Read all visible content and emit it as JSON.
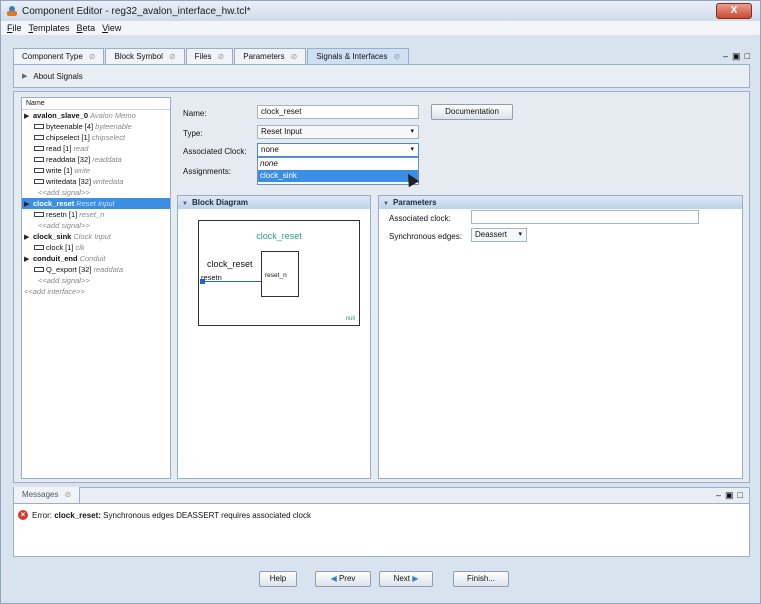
{
  "window": {
    "title": "Component Editor - reg32_avalon_interface_hw.tcl*",
    "close": "X"
  },
  "menu": [
    "File",
    "Templates",
    "Beta",
    "View"
  ],
  "tabs": [
    {
      "label": "Component Type"
    },
    {
      "label": "Block Symbol"
    },
    {
      "label": "Files"
    },
    {
      "label": "Parameters"
    },
    {
      "label": "Signals & Interfaces"
    }
  ],
  "tab_close_glyph": "⊘",
  "win_ctrls": [
    "–",
    "▣",
    "□"
  ],
  "about": "About Signals",
  "tree": {
    "header": "Name",
    "items": [
      {
        "label": "avalon_slave_0",
        "type": "Avalon Memo",
        "kind": "iface"
      },
      {
        "label": "byteenable [4]",
        "type": "byteenable",
        "kind": "sig"
      },
      {
        "label": "chipselect [1]",
        "type": "chipselect",
        "kind": "sig"
      },
      {
        "label": "read [1]",
        "type": "read",
        "kind": "sig"
      },
      {
        "label": "readdata [32]",
        "type": "readdata",
        "kind": "sig"
      },
      {
        "label": "write [1]",
        "type": "write",
        "kind": "sig"
      },
      {
        "label": "writedata [32]",
        "type": "writedata",
        "kind": "sig"
      },
      {
        "label": "<<add signal>>",
        "type": "",
        "kind": "add"
      },
      {
        "label": "clock_reset",
        "type": "Reset Input",
        "kind": "iface",
        "selected": true
      },
      {
        "label": "resetn [1]",
        "type": "reset_n",
        "kind": "sig"
      },
      {
        "label": "<<add signal>>",
        "type": "",
        "kind": "add"
      },
      {
        "label": "clock_sink",
        "type": "Clock Input",
        "kind": "iface"
      },
      {
        "label": "clock [1]",
        "type": "clk",
        "kind": "sig"
      },
      {
        "label": "conduit_end",
        "type": "Conduit",
        "kind": "iface"
      },
      {
        "label": "Q_export [32]",
        "type": "readdata",
        "kind": "sig"
      },
      {
        "label": "<<add signal>>",
        "type": "",
        "kind": "add"
      },
      {
        "label": "<<add interface>>",
        "type": "",
        "kind": "addi"
      }
    ]
  },
  "form": {
    "name_label": "Name:",
    "name_value": "clock_reset",
    "doc_button": "Documentation",
    "type_label": "Type:",
    "type_value": "Reset Input",
    "clock_label": "Associated Clock:",
    "clock_value": "none",
    "assign_label": "Assignments:",
    "clock_options": [
      "none",
      "clock_sink"
    ],
    "dd_glyph": "▾"
  },
  "block_diagram": {
    "header": "Block Diagram",
    "title": "clock_reset",
    "name": "clock_reset",
    "port_left": "resetn",
    "port_right": "reset_n",
    "footer": "null"
  },
  "params": {
    "header": "Parameters",
    "assoc_clock_label": "Associated clock:",
    "assoc_clock_value": "",
    "sync_edges_label": "Synchronous edges:",
    "sync_edges_value": "Deassert"
  },
  "messages": {
    "tab": "Messages",
    "err_prefix": "Error:",
    "err_subject": "clock_reset:",
    "err_text": "Synchronous edges DEASSERT requires associated clock"
  },
  "buttons": {
    "help": "Help",
    "prev": "Prev",
    "next": "Next",
    "finish": "Finish..."
  }
}
